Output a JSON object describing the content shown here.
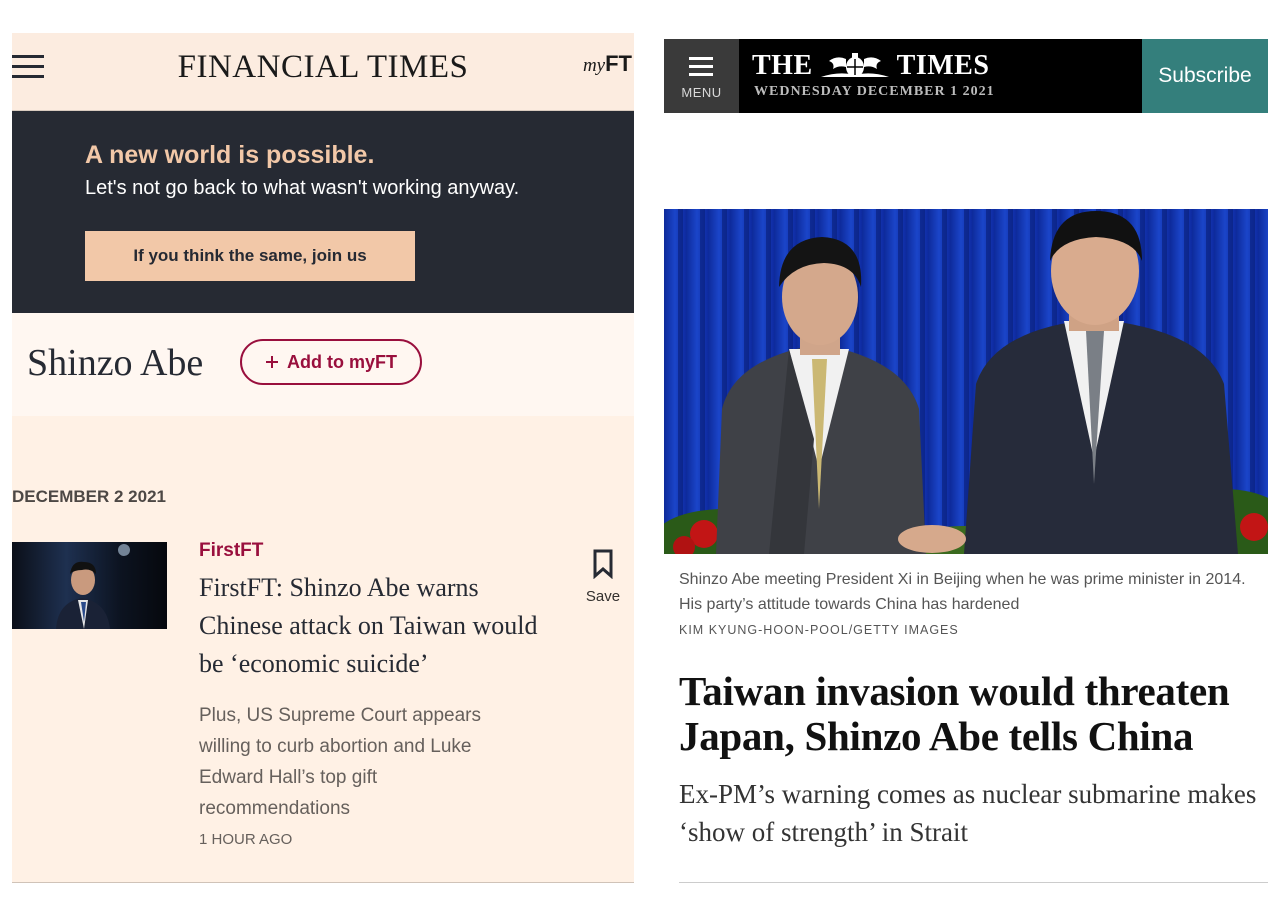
{
  "ft": {
    "logo": "FINANCIAL TIMES",
    "myft_prefix": "my",
    "myft_suffix": "FT",
    "promo": {
      "headline": "A new world is possible.",
      "subline": "Let's not go back to what wasn't working anyway.",
      "button": "If you think the same, join us"
    },
    "topic": {
      "title": "Shinzo Abe",
      "add_button": "Add to myFT"
    },
    "date_heading": "DECEMBER 2 2021",
    "article": {
      "tag": "FirstFT",
      "headline": "FirstFT: Shinzo Abe warns Chinese attack on Taiwan would be ‘economic suicide’",
      "standfirst": "Plus, US Supreme Court appears willing to curb abortion and Luke Edward Hall’s top gift recommendations",
      "time": "1 HOUR AGO",
      "save_label": "Save"
    },
    "colors": {
      "claret": "#990f3d",
      "paper": "#fff1e5",
      "promo_bg": "#262a33"
    }
  },
  "times": {
    "menu_label": "MENU",
    "logo_left": "THE",
    "logo_right": "TIMES",
    "date": "WEDNESDAY DECEMBER 1 2021",
    "subscribe": "Subscribe",
    "caption": "Shinzo Abe meeting President Xi in Beijing when he was prime minister in 2014. His party’s attitude towards China has hardened",
    "credit": "KIM KYUNG-HOON-POOL/GETTY IMAGES",
    "headline": "Taiwan invasion would threaten Japan, Shinzo Abe tells China",
    "standfirst": "Ex-PM’s warning comes as nuclear submarine makes ‘show of strength’ in Strait",
    "colors": {
      "subscribe_bg": "#347f7c"
    }
  }
}
